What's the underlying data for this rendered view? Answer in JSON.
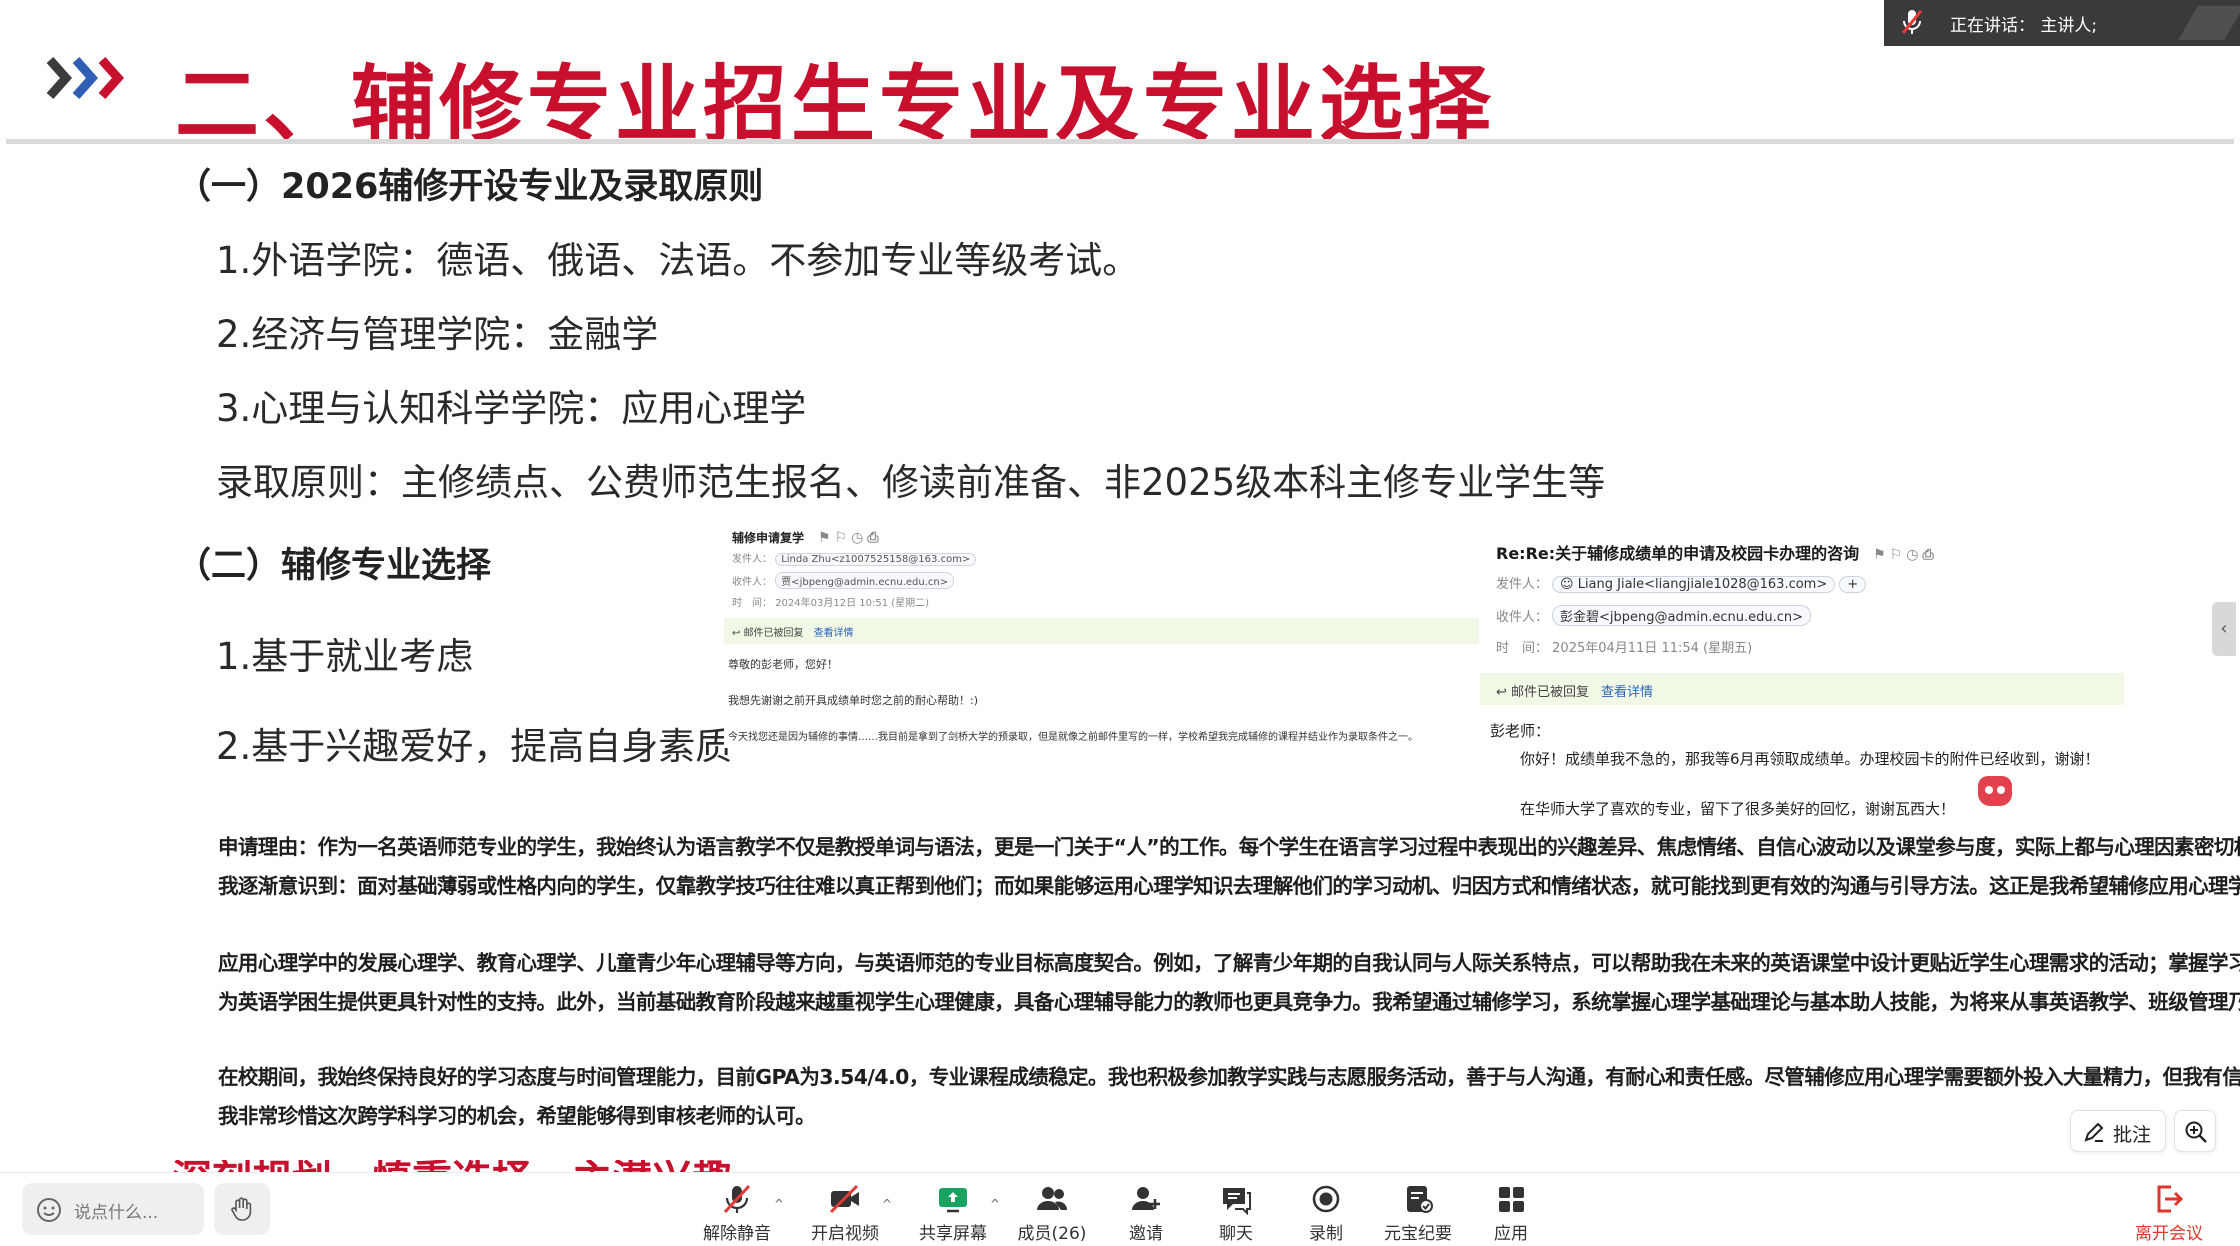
{
  "slide": {
    "title": "二、辅修专业招生专业及专业选择",
    "section1_heading": "（一）2026辅修开设专业及录取原则",
    "section1_items": [
      "1.外语学院：德语、俄语、法语。不参加专业等级考试。",
      "2.经济与管理学院：金融学",
      "3.心理与认知科学学院：应用心理学",
      "录取原则：主修绩点、公费师范生报名、修读前准备、非2025级本科主修专业学生等"
    ],
    "section2_heading": "（二）辅修专业选择",
    "section2_items": [
      "1.基于就业考虑",
      "2.基于兴趣爱好，提高自身素质"
    ],
    "partial_next_line": {
      "red": "深刻规划、慎重选择、主潜兴趣",
      "rest": ""
    },
    "application_reason": [
      "申请理由：作为一名英语师范专业的学生，我始终认为语言教学不仅是教授单词与语法，更是一门关于“人”的工作。每个学生在语言学习过程中表现出的兴趣差异、焦虑情绪、自信心波动以及课堂参与度，实际上都与心理因素密切相关。在日常的教育见习和微格教学训练中，",
      "我逐渐意识到：面对基础薄弱或性格内向的学生，仅靠教学技巧往往难以真正帮到他们；而如果能够运用心理学知识去理解他们的学习动机、归因方式和情绪状态，就可能找到更有效的沟通与引导方法。这正是我希望辅修应用心理学的最初动力。",
      "",
      "应用心理学中的发展心理学、教育心理学、儿童青少年心理辅导等方向，与英语师范的专业目标高度契合。例如，了解青少年期的自我认同与人际关系特点，可以帮助我在未来的英语课堂中设计更贴近学生心理需求的活动；掌握学习动机的激发策略与焦虑干预技巧，则有助于",
      "为英语学困生提供更具针对性的支持。此外，当前基础教育阶段越来越重视学生心理健康，具备心理辅导能力的教师也更具竞争力。我希望通过辅修学习，系统掌握心理学基础理论与基本助人技能，为将来从事英语教学、班级管理乃至教育咨询工作打下坚实的跨学科基础。",
      "",
      "在校期间，我始终保持良好的学习态度与时间管理能力，目前GPA为3.54/4.0，专业课程成绩稳定。我也积极参加教学实践与志愿服务活动，善于与人沟通，有耐心和责任感。尽管辅修应用心理学需要额外投入大量精力，但我有信心兼顾主修与辅修，并将所学真正融会贯通。",
      "我非常珍惜这次跨学科学习的机会，希望能够得到审核老师的认可。"
    ]
  },
  "email_left": {
    "subject": "辅修申请复学",
    "from_label": "发件人：",
    "from_value": "Linda Zhu<z1007525158@163.com>",
    "to_label": "收件人：",
    "to_value": "贾<jbpeng@admin.ecnu.edu.cn>",
    "time_label": "时　间：",
    "time_value": "2024年03月12日 10:51 (星期二)",
    "replied_text": "邮件已被回复",
    "view_detail": "查看详情",
    "body_lines": [
      "尊敬的彭老师，您好！",
      "我想先谢谢之前开具成绩单时您之前的耐心帮助！:)",
      "今天找您还是因为辅修的事情……我目前是拿到了剑桥大学的预录取，但是就像之前邮件里写的一样，学校希望我完成辅修的课程并结业作为录取条件之一。"
    ]
  },
  "email_right": {
    "subject": "Re:Re:关于辅修成绩单的申请及校园卡办理的咨询",
    "from_label": "发件人：",
    "from_value": "Liang Jiale<liangjiale1028@163.com>",
    "to_label": "收件人：",
    "to_value": "彭金碧<jbpeng@admin.ecnu.edu.cn>",
    "time_label": "时　间：",
    "time_value": "2025年04月11日 11:54 (星期五)",
    "replied_text": "邮件已被回复",
    "view_detail": "查看详情",
    "salutation": "彭老师：",
    "body_line1": "你好！成绩单我不急的，那我等6月再领取成绩单。办理校园卡的附件已经收到，谢谢！",
    "body_line2": "在华师大学了喜欢的专业，留下了很多美好的回忆，谢谢瓦西大！"
  },
  "meeting": {
    "speaker_label": "正在讲话：",
    "speaker_name": "主讲人;",
    "chat_placeholder": "说点什么...",
    "annotate_label": "批注",
    "toolbar": [
      {
        "label": "解除静音",
        "icon": "mic-muted-icon"
      },
      {
        "label": "开启视频",
        "icon": "video-off-icon"
      },
      {
        "label": "共享屏幕",
        "icon": "share-screen-icon"
      },
      {
        "label": "成员(26)",
        "icon": "members-icon"
      },
      {
        "label": "邀请",
        "icon": "invite-icon"
      },
      {
        "label": "聊天",
        "icon": "chat-icon"
      },
      {
        "label": "录制",
        "icon": "record-icon"
      },
      {
        "label": "元宝纪要",
        "icon": "notes-icon"
      },
      {
        "label": "应用",
        "icon": "apps-icon"
      },
      {
        "label": "离开会议",
        "icon": "leave-icon"
      }
    ],
    "colors": {
      "accent_red": "#c8102e",
      "share_green": "#1aa260",
      "leave_red": "#e0352b"
    }
  }
}
